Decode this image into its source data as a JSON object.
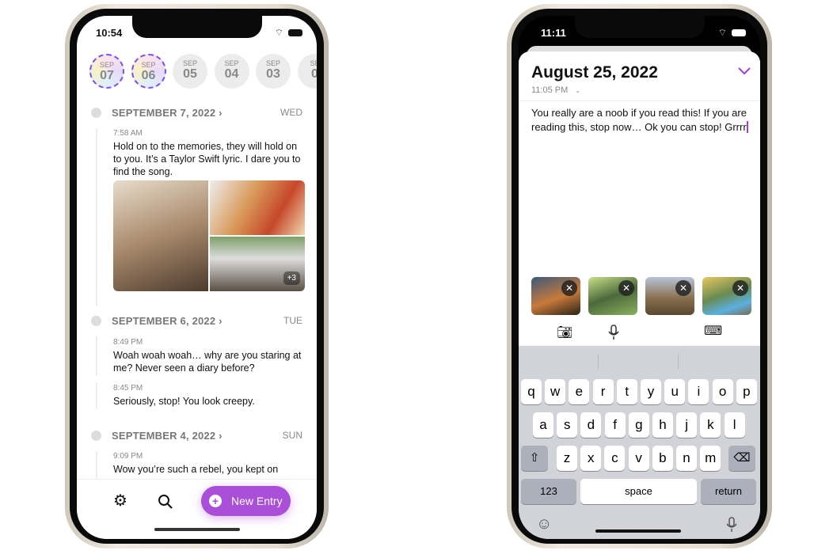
{
  "left_phone": {
    "status_time": "10:54",
    "day_strip": [
      {
        "month": "SEP",
        "day": "07",
        "has_entry": true
      },
      {
        "month": "SEP",
        "day": "06",
        "has_entry": true
      },
      {
        "month": "SEP",
        "day": "05",
        "has_entry": false
      },
      {
        "month": "SEP",
        "day": "04",
        "has_entry": false
      },
      {
        "month": "SEP",
        "day": "03",
        "has_entry": false
      },
      {
        "month": "SE",
        "day": "0",
        "has_entry": false
      }
    ],
    "days": [
      {
        "date": "SEPTEMBER 7, 2022",
        "weekday": "WED",
        "entries": [
          {
            "time": "7:58 AM",
            "text": "Hold on to the memories, they will hold on to you. It’s a Taylor Swift lyric. I dare you to find the song.",
            "extra_photos": "+3"
          }
        ]
      },
      {
        "date": "SEPTEMBER 6, 2022",
        "weekday": "TUE",
        "entries": [
          {
            "time": "8:49 PM",
            "text": "Woah woah woah… why are you staring at me? Never seen a diary before?"
          },
          {
            "time": "8:45 PM",
            "text": "Seriously, stop! You look creepy."
          }
        ]
      },
      {
        "date": "SEPTEMBER 4, 2022",
        "weekday": "SUN",
        "entries": [
          {
            "time": "9:09 PM",
            "text": "Wow you’re such a rebel, you kept on"
          }
        ]
      }
    ],
    "toolbar": {
      "settings_icon": "gear-icon",
      "search_icon": "search-icon",
      "new_entry_label": "New Entry",
      "accent": "#a94fd8"
    }
  },
  "right_phone": {
    "status_time": "11:11",
    "entry_date": "August 25, 2022",
    "entry_time": "11:05 PM",
    "entry_text": "You really are a noob if you read this! If you are reading this, stop now… Ok you can stop! Grrrr",
    "accent": "#a33ee0",
    "attachments": 4,
    "keyboard": {
      "row1": [
        "q",
        "w",
        "e",
        "r",
        "t",
        "y",
        "u",
        "i",
        "o",
        "p"
      ],
      "row2": [
        "a",
        "s",
        "d",
        "f",
        "g",
        "h",
        "j",
        "k",
        "l"
      ],
      "row3": [
        "z",
        "x",
        "c",
        "v",
        "b",
        "n",
        "m"
      ],
      "numbers": "123",
      "space": "space",
      "return": "return"
    }
  }
}
